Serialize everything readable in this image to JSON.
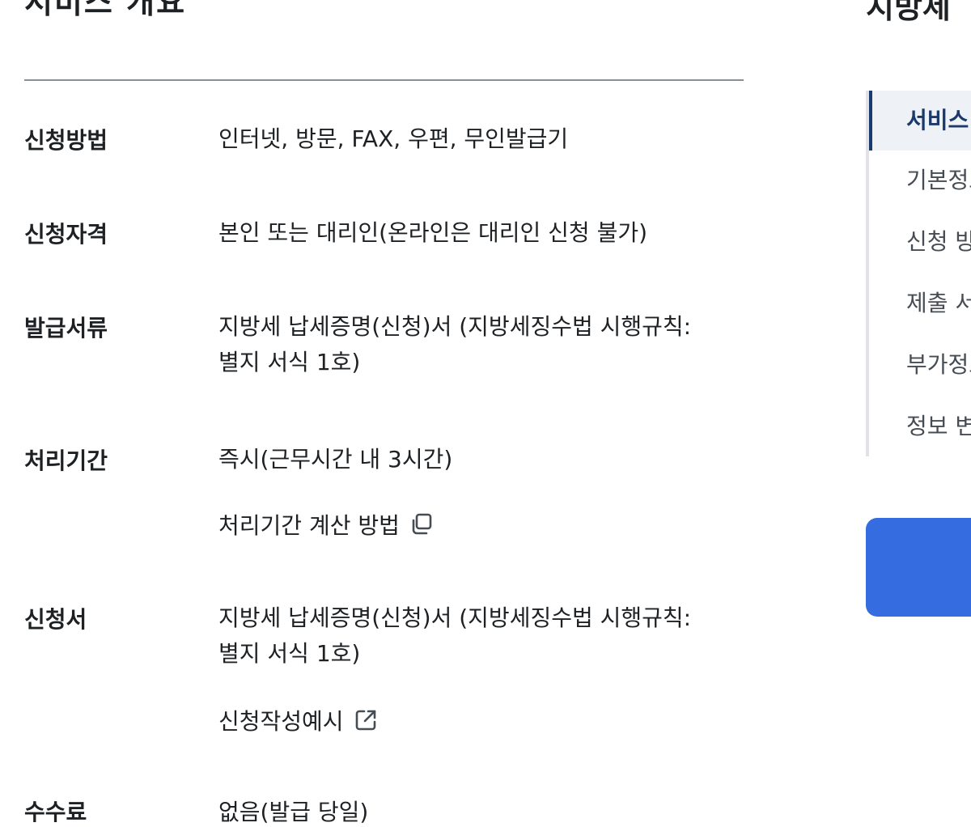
{
  "header": {
    "title": "서비스 개요",
    "sidebar_title": "지방세"
  },
  "info": [
    {
      "label": "신청방법",
      "lines": [
        "인터넷, 방문, FAX, 우편, 무인발급기"
      ]
    },
    {
      "label": "신청자격",
      "lines": [
        "본인 또는 대리인(온라인은 대리인 신청 불가)"
      ]
    },
    {
      "label": "발급서류",
      "lines": [
        "지방세 납세증명(신청)서 (지방세징수법 시행규칙:",
        "별지 서식 1호)"
      ]
    },
    {
      "label": "처리기간",
      "lines": [
        "즉시(근무시간 내 3시간)"
      ],
      "link": "처리기간 계산 방법"
    },
    {
      "label": "신청서",
      "lines": [
        "지방세 납세증명(신청)서 (지방세징수법 시행규칙:",
        "별지 서식 1호)"
      ],
      "link": "신청작성예시"
    },
    {
      "label": "수수료",
      "lines": [
        "없음(발급 당일)"
      ]
    }
  ],
  "sidebar": {
    "items": [
      {
        "label": "서비스 개요",
        "active": true
      },
      {
        "label": "기본정보"
      },
      {
        "label": "신청 방법"
      },
      {
        "label": "제출 서류"
      },
      {
        "label": "부가정보"
      },
      {
        "label": "정보 변경"
      }
    ],
    "button_color": "#356de0"
  },
  "colors": {
    "accent": "#1b3a6b",
    "button": "#356de0",
    "text": "#1e2124"
  }
}
